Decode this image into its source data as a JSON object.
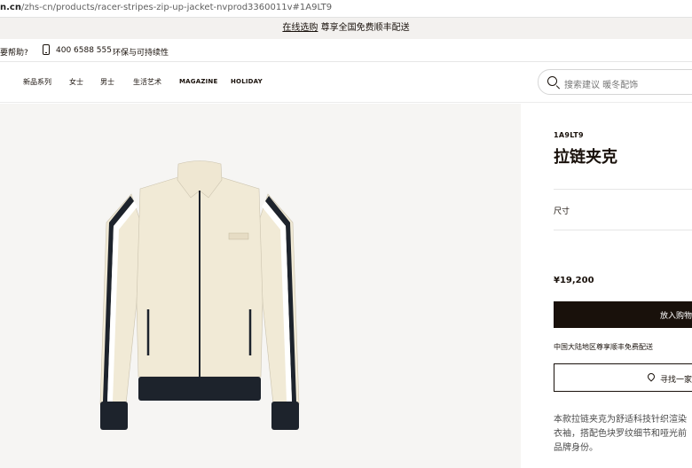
{
  "browser": {
    "url_host": "n.cn",
    "url_path": "/zhs-cn/products/racer-stripes-zip-up-jacket-nvprod3360011v#1A9LT9"
  },
  "promo": {
    "link_text": "在线选购",
    "message": "尊享全国免费顺丰配送"
  },
  "utility": {
    "help_text": "要帮助?",
    "phone": "400 6588 555",
    "sustainability": "环保与可持续性"
  },
  "nav": {
    "items": [
      "新品系列",
      "女士",
      "男士",
      "生活艺术",
      "MAGAZINE",
      "HOLIDAY"
    ]
  },
  "search": {
    "placeholder": "搜索建议  暖冬配饰"
  },
  "product": {
    "sku": "1A9LT9",
    "name": "拉链夹克",
    "size_label": "尺寸",
    "price": "¥19,200",
    "add_to_cart": "放入购物",
    "shipping_note": "中国大陆地区尊享顺丰免费配送",
    "find_store": "寻找一家",
    "description_lines": [
      "本款拉链夹克为舒适科技针织渲染",
      "衣袖，搭配色块罗纹细节和哑光前",
      "品牌身份。"
    ],
    "image_alt": "拉链夹克"
  },
  "colors": {
    "cart_bg": "#19110b",
    "stage_bg": "#f6f5f3",
    "promo_bg": "#f3f1ef",
    "jacket_body": "#f1ead6",
    "jacket_trim": "#1d232c"
  },
  "icons": {
    "phone": "phone-icon",
    "search": "search-icon",
    "store": "location-pin-icon"
  }
}
